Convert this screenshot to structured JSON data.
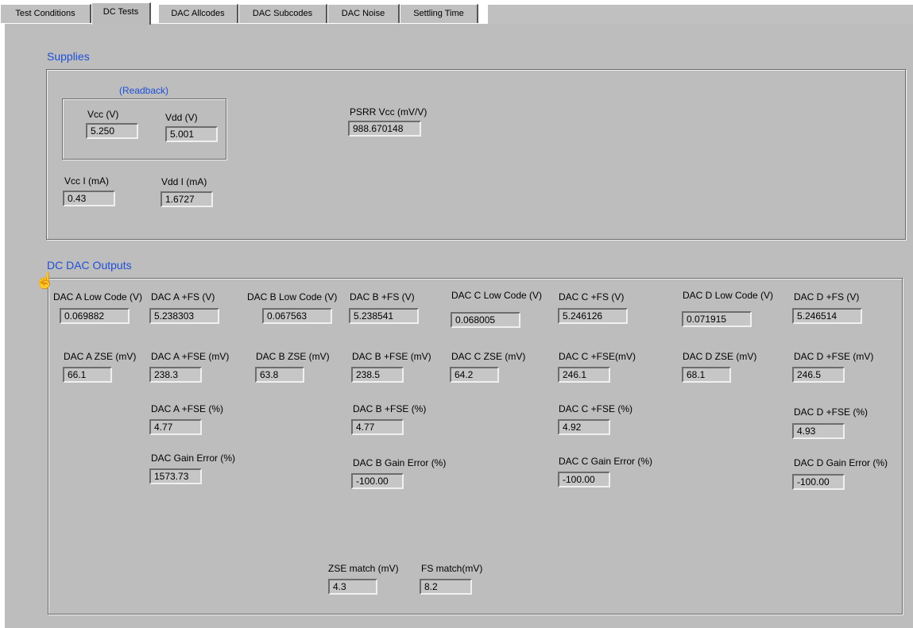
{
  "tabs": [
    "Test Conditions",
    "DC Tests",
    "DAC Allcodes",
    "DAC Subcodes",
    "DAC Noise",
    "Settling Time"
  ],
  "supplies": {
    "title": "Supplies",
    "readback_label": "(Readback)",
    "vcc_label": "Vcc (V)",
    "vcc_value": "5.250",
    "vdd_label": "Vdd (V)",
    "vdd_value": "5.001",
    "psrr_label": "PSRR Vcc (mV/V)",
    "psrr_value": "988.670148",
    "vcci_label": "Vcc I (mA)",
    "vcci_value": "0.43",
    "vddi_label": "Vdd I (mA)",
    "vddi_value": "1.6727"
  },
  "dc": {
    "title": "DC DAC Outputs",
    "a_low_label": "DAC A Low Code (V)",
    "a_low_value": "0.069882",
    "a_fs_label": "DAC A +FS (V)",
    "a_fs_value": "5.238303",
    "b_low_label": "DAC B Low Code (V)",
    "b_low_value": "0.067563",
    "b_fs_label": "DAC B +FS (V)",
    "b_fs_value": "5.238541",
    "c_low_label": "DAC C Low Code (V)",
    "c_low_value": "0.068005",
    "c_fs_label": "DAC C +FS (V)",
    "c_fs_value": "5.246126",
    "d_low_label": "DAC D Low Code (V)",
    "d_low_value": "0.071915",
    "d_fs_label": "DAC D +FS (V)",
    "d_fs_value": "5.246514",
    "a_zse_label": "DAC A ZSE (mV)",
    "a_zse_value": "66.1",
    "a_fse_label": "DAC A +FSE (mV)",
    "a_fse_value": "238.3",
    "b_zse_label": "DAC B ZSE (mV)",
    "b_zse_value": "63.8",
    "b_fse_label": "DAC B +FSE (mV)",
    "b_fse_value": "238.5",
    "c_zse_label": "DAC C ZSE (mV)",
    "c_zse_value": "64.2",
    "c_fse_label": "DAC C +FSE(mV)",
    "c_fse_value": "246.1",
    "d_zse_label": "DAC D ZSE (mV)",
    "d_zse_value": "68.1",
    "d_fse_label": "DAC D +FSE (mV)",
    "d_fse_value": "246.5",
    "a_fsep_label": "DAC A +FSE (%)",
    "a_fsep_value": "4.77",
    "b_fsep_label": "DAC B +FSE (%)",
    "b_fsep_value": "4.77",
    "c_fsep_label": "DAC C  +FSE (%)",
    "c_fsep_value": "4.92",
    "d_fsep_label": "DAC D +FSE (%)",
    "d_fsep_value": "4.93",
    "a_gain_label": "DAC Gain Error (%)",
    "a_gain_value": "1573.73",
    "b_gain_label": "DAC B Gain Error (%)",
    "b_gain_value": "-100.00",
    "c_gain_label": "DAC C Gain Error (%)",
    "c_gain_value": "-100.00",
    "d_gain_label": "DAC D Gain Error (%)",
    "d_gain_value": "-100.00",
    "zse_match_label": "ZSE match (mV)",
    "zse_match_value": "4.3",
    "fs_match_label": "FS match(mV)",
    "fs_match_value": "8.2"
  }
}
